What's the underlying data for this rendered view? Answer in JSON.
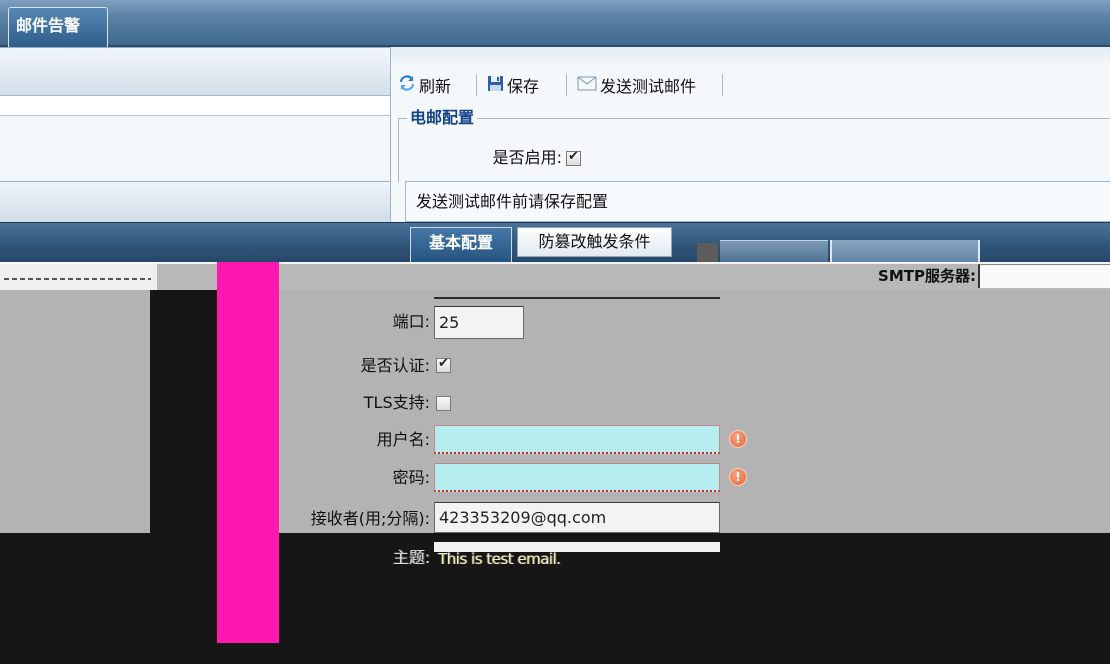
{
  "header": {
    "tab_label": "邮件告警"
  },
  "toolbar": {
    "refresh_label": "刷新",
    "save_label": "保存",
    "send_test_label": "发送测试邮件"
  },
  "mail_config": {
    "legend": "电邮配置",
    "enable_label": "是否启用:",
    "enable_checked": true
  },
  "notice": "发送测试邮件前请保存配置",
  "tabs": [
    {
      "label": "基本配置",
      "selected": true
    },
    {
      "label": "防篡改触发条件",
      "selected": false
    }
  ],
  "form": {
    "smtp_label": "SMTP服务器:",
    "port_label": "端口:",
    "port_value": "25",
    "auth_label": "是否认证:",
    "auth_checked": true,
    "tls_label": "TLS支持:",
    "tls_checked": false,
    "username_label": "用户名:",
    "username_invalid": true,
    "password_label": "密码:",
    "password_invalid": true,
    "receivers_label": "接收者(用;分隔):",
    "receivers_value": "423353209@qq.com",
    "subject_label": "主题:",
    "subject_value": "This is test email."
  },
  "icons": {
    "refresh": "refresh-icon",
    "save": "save-icon",
    "send_test": "mail-icon",
    "invalid": "error-icon",
    "checkbox_tick": "check-icon"
  },
  "colors": {
    "magenta": "#ff18b0",
    "black": "#161616",
    "gray": "#b3b3b3",
    "invalid_field": "#b6eef0",
    "error_icon": "#e5673a",
    "legend": "#15428b"
  }
}
